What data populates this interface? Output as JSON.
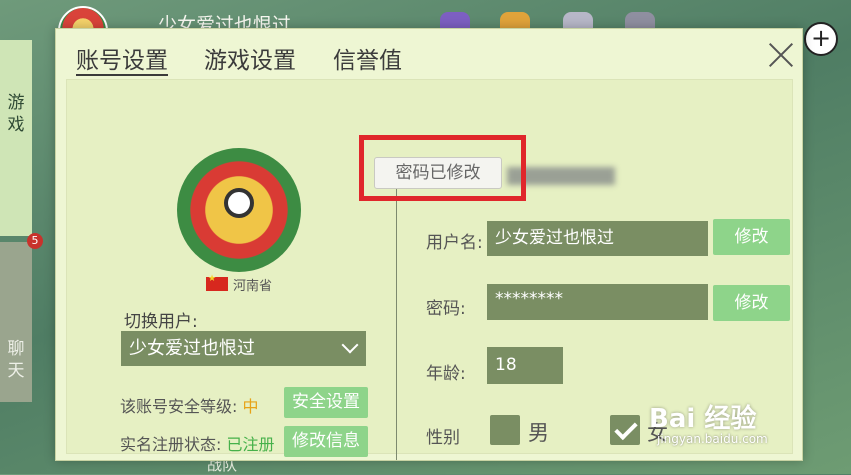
{
  "background": {
    "username": "少女爱过也恨过",
    "side_tabs": {
      "game": "游\n戏",
      "chat": "聊\n天"
    },
    "chat_badge": "5",
    "bottom_tab": "战队",
    "watermark": {
      "main": "Bai 经验",
      "sub": "jingyan.baidu.com"
    }
  },
  "dialog": {
    "tabs": [
      "账号设置",
      "游戏设置",
      "信誉值"
    ],
    "active_tab": "账号设置",
    "profile": {
      "province": "河南省"
    },
    "switch_user": {
      "label": "切换用户:",
      "value": "少女爱过也恨过"
    },
    "security": {
      "label": "该账号安全等级:",
      "level": "中",
      "button": "安全设置"
    },
    "realname": {
      "label": "实名注册状态:",
      "status": "已注册",
      "button": "修改信息"
    },
    "toast": "密码已修改",
    "form": {
      "username_label": "用户名:",
      "username_value": "少女爱过也恨过",
      "password_label": "密码:",
      "password_value": "********",
      "age_label": "年龄:",
      "age_value": "18",
      "gender_label": "性别",
      "male_label": "男",
      "female_label": "女",
      "gender_selected": "女",
      "edit_button": "修改"
    }
  },
  "colors": {
    "accent_green": "#8ed48a",
    "field": "#7a8e63",
    "highlight": "#e0272b",
    "level": "#e7a316"
  }
}
